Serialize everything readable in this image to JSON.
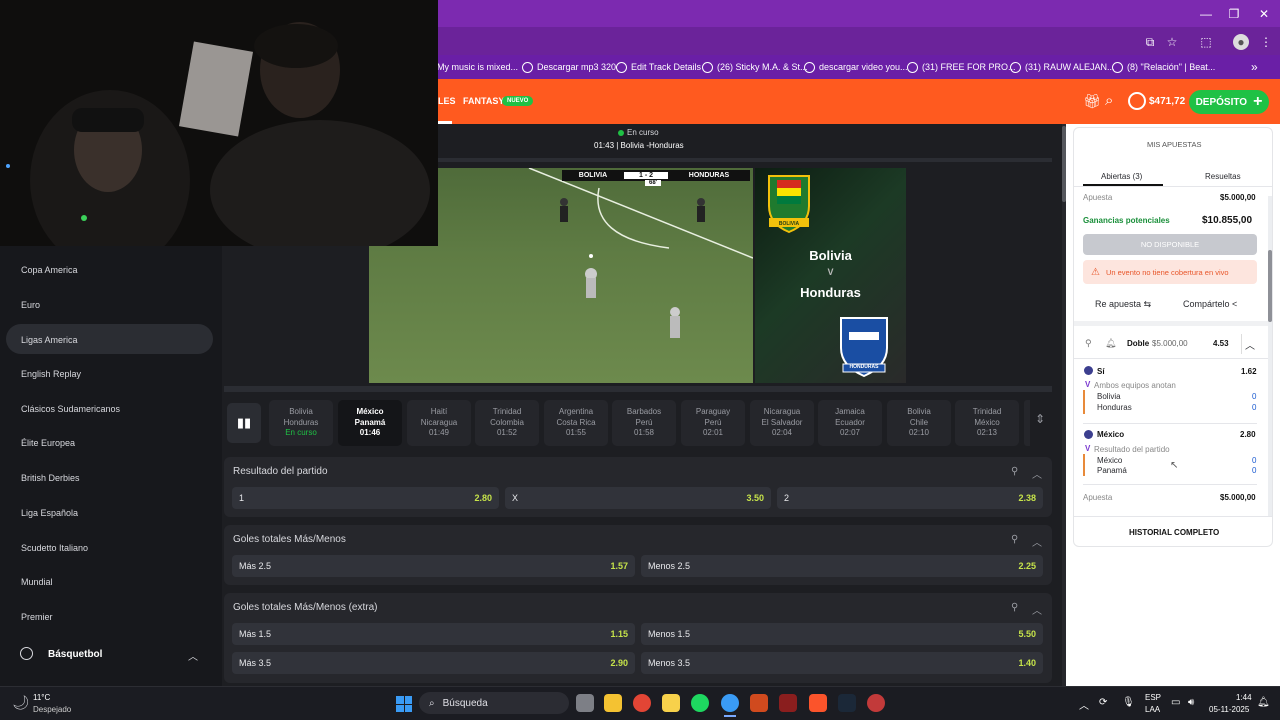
{
  "browser": {
    "bookmarks": [
      "My music is mixed...",
      "Descargar mp3 320",
      "Edit Track Details",
      "(26) Sticky M.A. & St...",
      "descargar video you...",
      "(31) FREE FOR PRO...",
      "(31) RAUW ALEJAN...",
      "(8) \"Relación\" | Beat..."
    ],
    "more_label": "»"
  },
  "header": {
    "nav": [
      "LES",
      "FANTASY"
    ],
    "new_badge": "NUEVO",
    "balance": "$471,72",
    "deposit_label": "DEPÓSITO"
  },
  "sidebar": {
    "items": [
      "Copa America",
      "Euro",
      "Ligas America",
      "English Replay",
      "Clásicos Sudamericanos",
      "Élite Europea",
      "British Derbies",
      "Liga Española",
      "Scudetto Italiano",
      "Mundial",
      "Premier"
    ],
    "active_index": 2,
    "section": "Básquetbol"
  },
  "stream": {
    "status": "En curso",
    "title": "01:43 | Bolivia -Honduras",
    "score_home": "BOLIVIA",
    "score": "1 - 2",
    "score_away": "HONDURAS",
    "minute": "68'",
    "promo_home": "Bolivia",
    "promo_vs": "V",
    "promo_away": "Honduras",
    "badge_home": "BOLIVIA",
    "badge_away": "HONDURAS"
  },
  "matches": [
    {
      "home": "Bolivia",
      "away": "Honduras",
      "time": "En curso",
      "live": true
    },
    {
      "home": "México",
      "away": "Panamá",
      "time": "01:46",
      "active": true
    },
    {
      "home": "Haití",
      "away": "Nicaragua",
      "time": "01:49"
    },
    {
      "home": "Trinidad",
      "away": "Colombia",
      "time": "01:52"
    },
    {
      "home": "Argentina",
      "away": "Costa Rica",
      "time": "01:55"
    },
    {
      "home": "Barbados",
      "away": "Perú",
      "time": "01:58"
    },
    {
      "home": "Paraguay",
      "away": "Perú",
      "time": "02:01"
    },
    {
      "home": "Nicaragua",
      "away": "El Salvador",
      "time": "02:04"
    },
    {
      "home": "Jamaica",
      "away": "Ecuador",
      "time": "02:07"
    },
    {
      "home": "Bolivia",
      "away": "Chile",
      "time": "02:10"
    },
    {
      "home": "Trinidad",
      "away": "México",
      "time": "02:13"
    }
  ],
  "markets": {
    "result": {
      "title": "Resultado del partido",
      "odds": [
        {
          "label": "1",
          "value": "2.80"
        },
        {
          "label": "X",
          "value": "3.50"
        },
        {
          "label": "2",
          "value": "2.38"
        }
      ]
    },
    "totals": {
      "title": "Goles totales Más/Menos",
      "odds": [
        {
          "label": "Más 2.5",
          "value": "1.57"
        },
        {
          "label": "Menos 2.5",
          "value": "2.25"
        }
      ]
    },
    "totals_extra": {
      "title": "Goles totales Más/Menos (extra)",
      "odds": [
        {
          "label": "Más 1.5",
          "value": "1.15"
        },
        {
          "label": "Menos 1.5",
          "value": "5.50"
        },
        {
          "label": "Más 3.5",
          "value": "2.90"
        },
        {
          "label": "Menos 3.5",
          "value": "1.40"
        }
      ]
    }
  },
  "betslip": {
    "title": "MIS APUESTAS",
    "tab_open": "Abiertas (3)",
    "tab_settled": "Resueltas",
    "stake_label_top": "Apuesta",
    "stake_top": "$5.000,00",
    "potential_label": "Ganancias potenciales",
    "potential": "$10.855,00",
    "unavailable": "NO DISPONIBLE",
    "warning": "Un evento no tiene cobertura en vivo",
    "rebet": "Re apuesta",
    "share": "Compártelo",
    "bet2_type": "Doble",
    "bet2_stake": "$5.000,00",
    "bet2_odds": "4.53",
    "sel1_pick": "Sí",
    "sel1_odds": "1.62",
    "sel1_market": "Ambos equipos anotan",
    "sel1_team1": "Bolivia",
    "sel1_score1": "0",
    "sel1_team2": "Honduras",
    "sel1_score2": "0",
    "sel2_pick": "México",
    "sel2_odds": "2.80",
    "sel2_market": "Resultado del partido",
    "sel2_team1": "México",
    "sel2_score1": "0",
    "sel2_team2": "Panamá",
    "sel2_score2": "0",
    "stake_label_bottom": "Apuesta",
    "stake_bottom": "$5.000,00",
    "history": "HISTORIAL COMPLETO"
  },
  "taskbar": {
    "weather_temp": "11°C",
    "weather_desc": "Despejado",
    "search": "Búsqueda",
    "lang": "ESP",
    "lang2": "LAA",
    "time": "1:44",
    "date": "05-11-2025"
  },
  "colors": {
    "brand": "#ff5a1f",
    "accent_green": "#1fc145",
    "odds_text": "#c6e34a",
    "browser": "#7c2ab0"
  }
}
